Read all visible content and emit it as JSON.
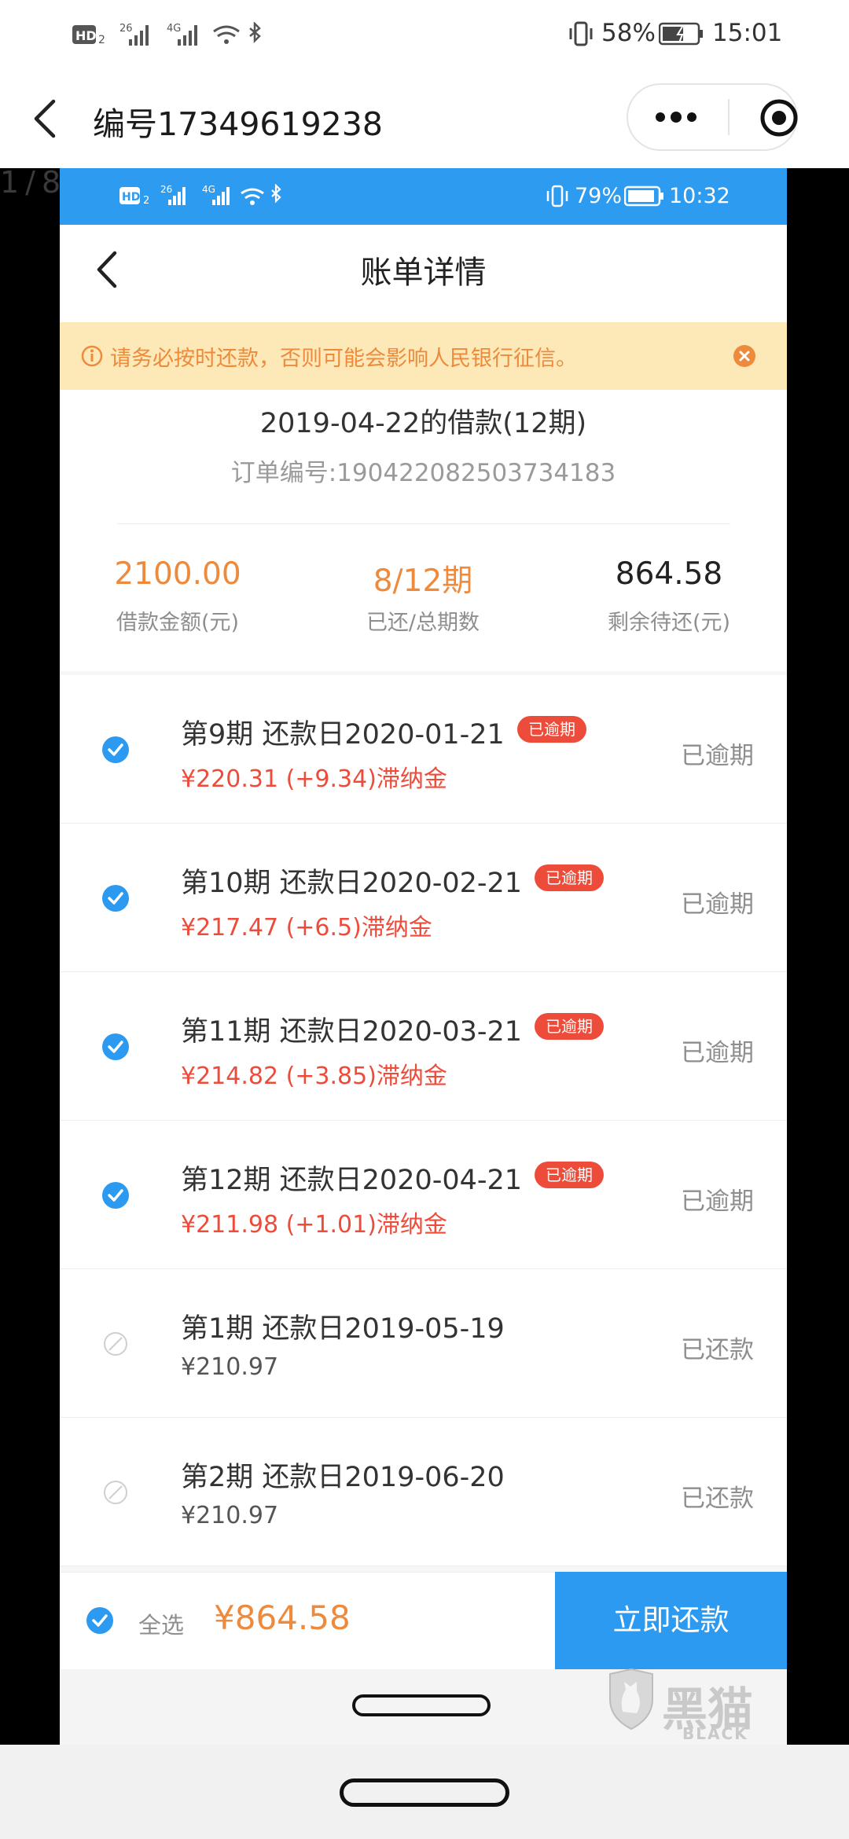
{
  "outer_status": {
    "network": "HD₂ ⁴⁶ ⁴⁶",
    "battery": "58%",
    "time": "15:01"
  },
  "outer_nav": {
    "title": "编号17349619238",
    "more_icon": "more-dots-icon",
    "close_icon": "target-close-icon"
  },
  "page_indicator": "1/8",
  "inner_status": {
    "battery": "79%",
    "time": "10:32"
  },
  "inner_nav": {
    "title": "账单详情"
  },
  "notice": {
    "text": "请务必按时还款，否则可能会影响人民银行征信。"
  },
  "loan": {
    "title": "2019-04-22的借款(12期)",
    "order_no": "订单编号:190422082503734183",
    "stats": [
      {
        "value": "2100.00",
        "label": "借款金额(元)",
        "color": "#ee8a3c"
      },
      {
        "value": "8/12期",
        "label": "已还/总期数",
        "color": "#ee8a3c"
      },
      {
        "value": "864.58",
        "label": "剩余待还(元)",
        "color": "#222222"
      }
    ]
  },
  "installments": [
    {
      "title": "第9期  还款日2020-01-21",
      "badge": "已逾期",
      "amount": "¥220.31  (+9.34)滞纳金",
      "status": "已逾期",
      "checked": true
    },
    {
      "title": "第10期  还款日2020-02-21",
      "badge": "已逾期",
      "amount": "¥217.47  (+6.5)滞纳金",
      "status": "已逾期",
      "checked": true
    },
    {
      "title": "第11期  还款日2020-03-21",
      "badge": "已逾期",
      "amount": "¥214.82  (+3.85)滞纳金",
      "status": "已逾期",
      "checked": true
    },
    {
      "title": "第12期  还款日2020-04-21",
      "badge": "已逾期",
      "amount": "¥211.98  (+1.01)滞纳金",
      "status": "已逾期",
      "checked": true
    },
    {
      "title": "第1期  还款日2019-05-19",
      "badge": "",
      "amount": "¥210.97",
      "status": "已还款",
      "checked": false
    },
    {
      "title": "第2期  还款日2019-06-20",
      "badge": "",
      "amount": "¥210.97",
      "status": "已还款",
      "checked": false
    }
  ],
  "bottom": {
    "select_all": "全选",
    "total": "¥864.58",
    "pay_button": "立即还款"
  },
  "watermark": {
    "cn": "黑猫",
    "en": "BLACK CAT"
  },
  "colors": {
    "accent": "#2b9af0",
    "orange": "#ee8a3c",
    "overdue": "#ee4c3a"
  }
}
